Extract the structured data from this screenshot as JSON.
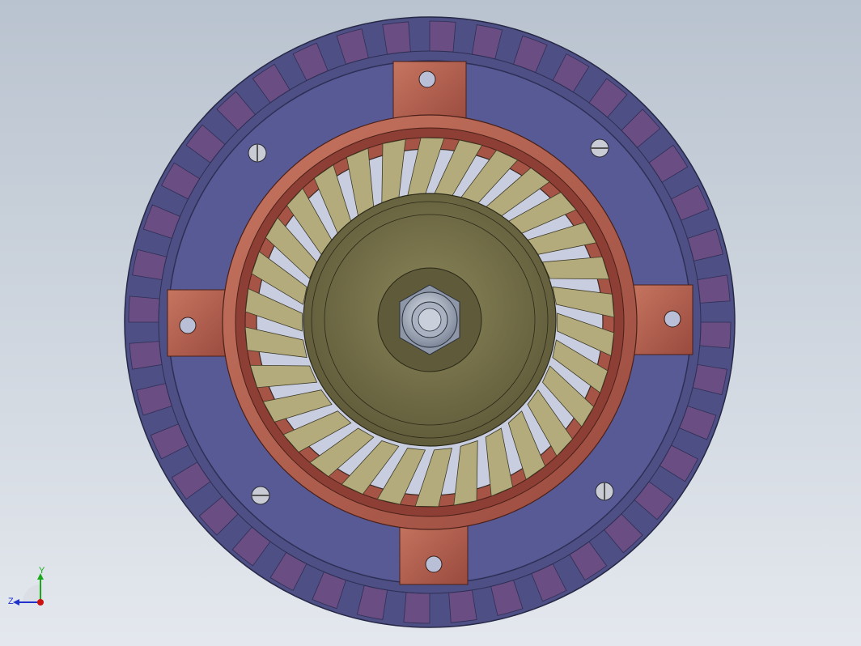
{
  "viewport": {
    "background_top": "#b9c3cf",
    "background_bottom": "#e4e8ee"
  },
  "model": {
    "outer_ring_color": "#4e4f85",
    "outer_ring_segment_color": "#6a4d82",
    "stator_plate_color": "#575a95",
    "flange_color": "#b0614f",
    "flange_dark_color": "#8d3f35",
    "blade_color": "#b4ab7d",
    "hub_color": "#6f6a45",
    "shaft_color": "#9aa3b3",
    "screw_icon": "slotted-screw-icon",
    "mounting_hole_icon": "mounting-hole-icon"
  },
  "triad": {
    "y_label": "Y",
    "z_label": "Z",
    "y_color": "#1aa81a",
    "z_color": "#2233cc",
    "x_color": "#cc1111"
  }
}
